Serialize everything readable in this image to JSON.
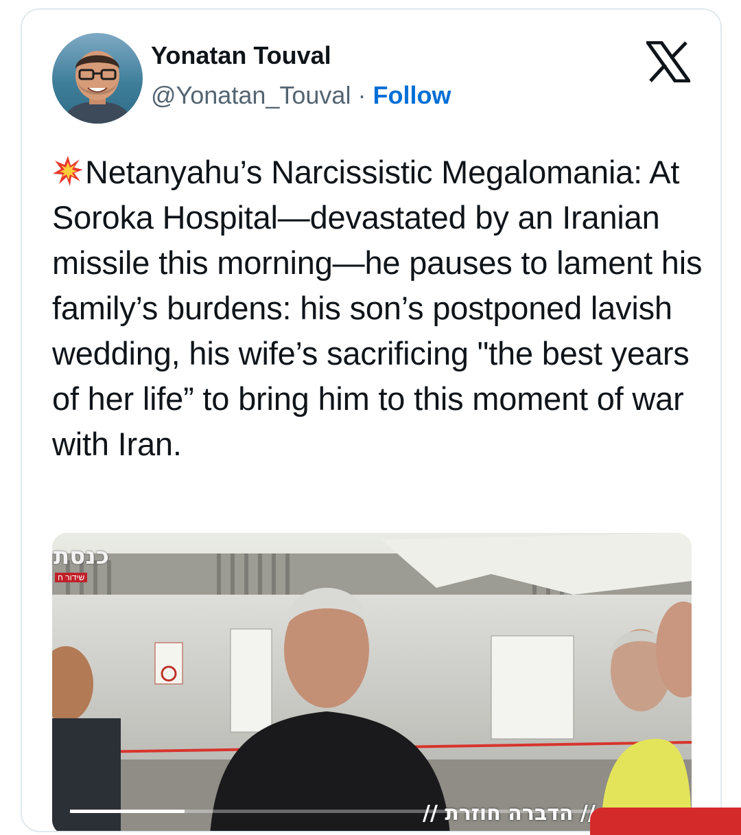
{
  "author": {
    "name": "Yonatan Touval",
    "handle": "@Yonatan_Touval",
    "separator": "·",
    "follow_label": "Follow"
  },
  "icons": {
    "brand": "x-logo-icon",
    "emoji": "collision-burst-icon",
    "avatar": "profile-photo"
  },
  "tweet": {
    "text": "Netanyahu’s Narcissistic Megalomania: At Soroka Hospital—devastated by an Iranian missile this morning—he pauses to lament his family’s burdens: his son’s postponed lavish wedding, his wife’s sacrificing \"the best years of her life” to bring him to this moment of war with Iran."
  },
  "video": {
    "channel_logo_text": "כנסת",
    "channel_sub_text": "שידור ח",
    "lower_third_text": "// הדברה חוזרת //",
    "progress_fraction": 0.19
  },
  "colors": {
    "follow": "#006fd6",
    "text": "#0f1419",
    "secondary": "#536471",
    "border": "#e1e8ed"
  }
}
